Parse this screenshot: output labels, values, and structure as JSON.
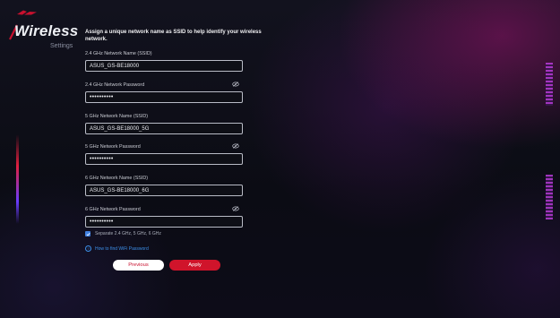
{
  "brand": {
    "title": "Wireless",
    "subtitle": "Settings"
  },
  "description": "Assign a unique network name as SSID to help identify your wireless network.",
  "fields": [
    {
      "label": "2.4 GHz Network Name (SSID)",
      "value": "ASUS_GS-BE18000"
    },
    {
      "label": "2.4 GHz Network Password",
      "value": "••••••••••"
    },
    {
      "label": "5 GHz Network Name (SSID)",
      "value": "ASUS_GS-BE18000_5G"
    },
    {
      "label": "5 GHz Network Password",
      "value": "••••••••••"
    },
    {
      "label": "6 GHz Network Name (SSID)",
      "value": "ASUS_GS-BE18000_6G"
    },
    {
      "label": "6 GHz Network Password",
      "value": "••••••••••"
    }
  ],
  "separate_checkbox": {
    "label": "Separate 2.4 GHz, 5 GHz, 6 GHz",
    "checked": true
  },
  "help_link": "How to find WiFi Password",
  "buttons": {
    "previous": "Previous",
    "apply": "Apply"
  },
  "colors": {
    "accent": "#d0142b",
    "link": "#3c8fe8",
    "checkbox": "#3f7fe0"
  },
  "icons": {
    "password_toggle": "eye-slash-icon",
    "help": "question-circle-icon",
    "logo": "rog-logo-icon"
  }
}
